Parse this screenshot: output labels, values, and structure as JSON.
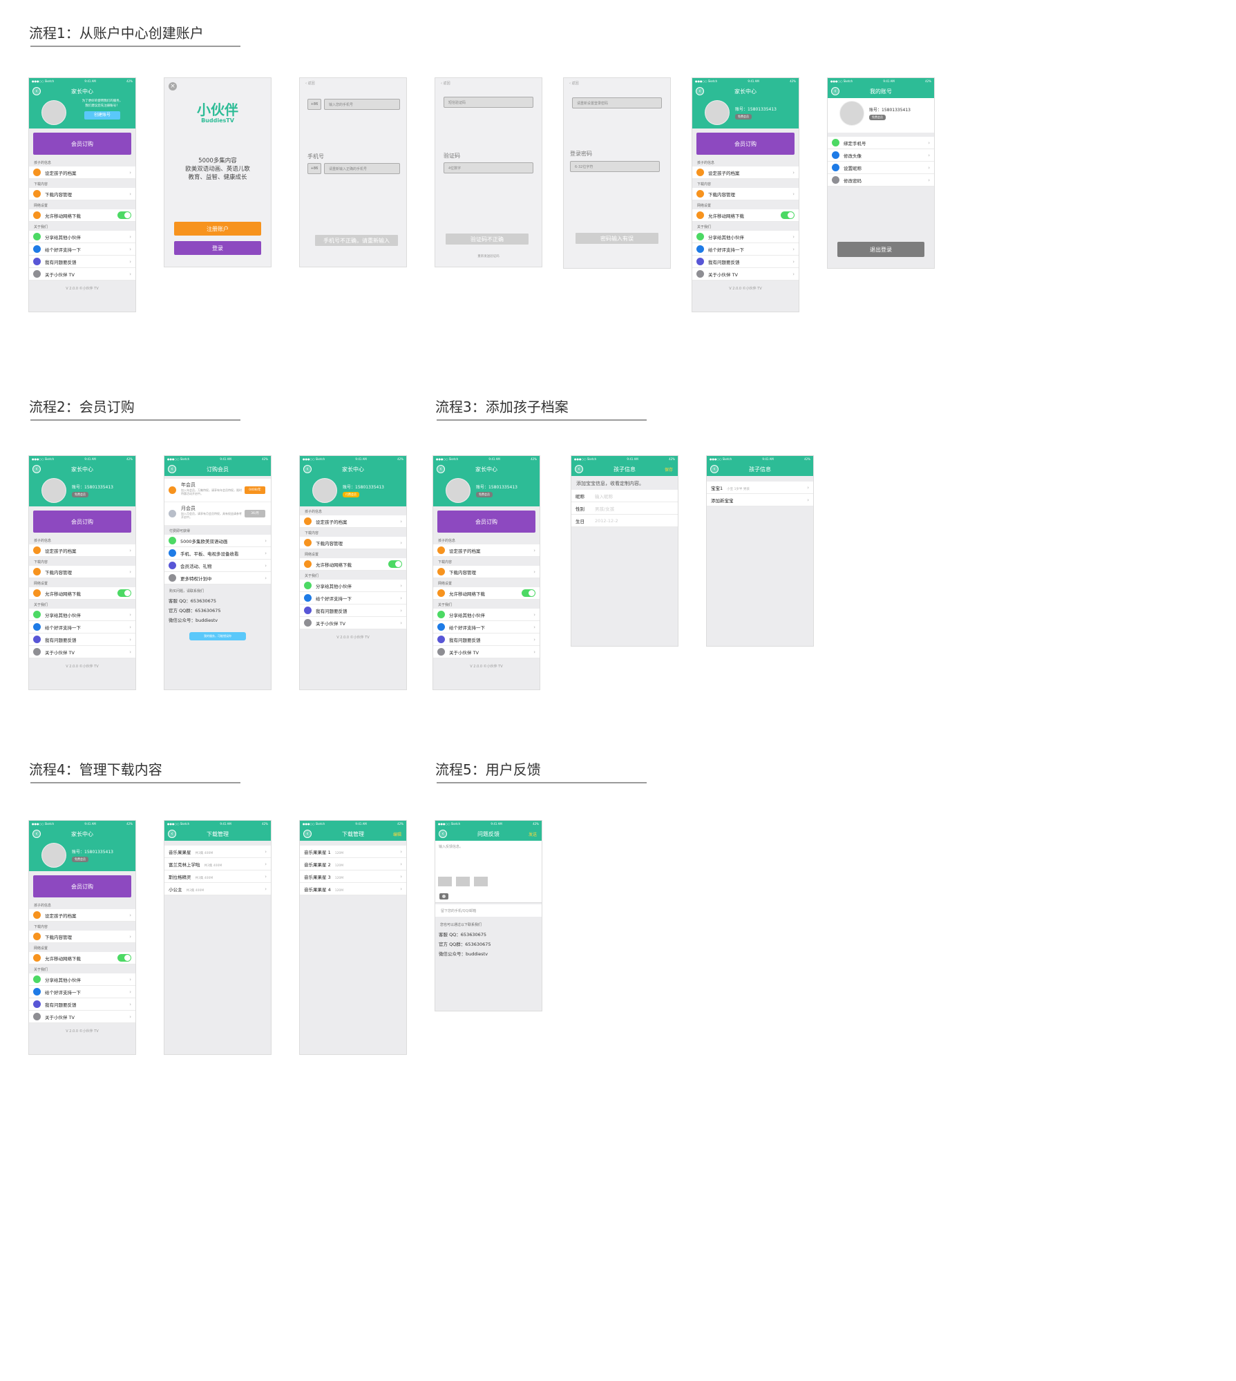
{
  "sections": {
    "s1": "流程1：从账户中心创建账户",
    "s2": "流程2：会员订购",
    "s3": "流程3：添加孩子档案",
    "s4": "流程4：管理下载内容",
    "s5": "流程5：用户反馈"
  },
  "status_bar": {
    "carrier": "●●●○○ Sketch",
    "time": "9:41 AM",
    "battery": "42%"
  },
  "family_center": {
    "title": "家长中心",
    "promo_line1": "为了更好的使用我们的服务，",
    "promo_line2": "我们建议您先注册账号！",
    "create_account": "创建账号",
    "account_number": "账号：15801335413",
    "badge_free": "免费会员",
    "badge_member": "付费会员",
    "membership_button": "会员订购",
    "group_child": "孩子的信息",
    "set_child": "设定孩子的档案",
    "group_download": "下载内容",
    "download_manage": "下载内容管理",
    "group_network": "网络设置",
    "allow_mobile": "允许移动网络下载",
    "group_about": "关于我们",
    "share": "分享给其他小伙伴",
    "rate": "给个好评支持一下",
    "feedback": "我有问题要反馈",
    "about": "关于小伙伴 TV",
    "version": "V 2.0.0 ©小伙伴 TV",
    "chevron": "›"
  },
  "welcome": {
    "close": "×",
    "logo_cn": "小伙伴",
    "logo_en": "BuddiesTV",
    "line1": "5000多集内容",
    "line2": "欧美双语动画、英语儿歌",
    "line3": "教育、益智、健康成长",
    "register": "注册账户",
    "login": "登录"
  },
  "phone_screen": {
    "back": "‹ 返回",
    "prefix": "+86",
    "placeholder1": "输入您的手机号",
    "label": "手机号",
    "placeholder2": "请重新输入正确的手机号",
    "error": "手机号不正确，请重新输入"
  },
  "code_screen": {
    "back": "‹ 返回",
    "placeholder1": "短信验证码",
    "label": "验证码",
    "placeholder2": "4位数字",
    "error": "验证码不正确",
    "resend": "重新发送验证码"
  },
  "password_screen": {
    "back": "‹ 返回",
    "placeholder1": "请重新设置登录密码",
    "label": "登录密码",
    "placeholder2": "6-32位字符",
    "error": "密码输入有误"
  },
  "my_account": {
    "title": "我的账号",
    "account_number": "账号：15801335413",
    "badge": "免费会员",
    "items": [
      "绑定手机号",
      "修改头像",
      "设置昵称",
      "修改密码"
    ],
    "logout": "退出登录"
  },
  "subscribe": {
    "title": "订购会员",
    "yearly": "年会员",
    "yearly_desc": "加入年会员，万集特权，请享有年会员特权，限时特惠活动开启中。",
    "yearly_price": "0408/年",
    "monthly": "月会员",
    "monthly_desc": "加入月会员，请享有月会员特权，具有权益请参考开启中。",
    "monthly_price": "36/月",
    "perks_title": "付费即可获得",
    "perks": [
      "5000多集欧美双语动画",
      "手机、平板、电视多设备收看",
      "会员活动、礼物",
      "更多特权计划中"
    ],
    "contact_title": "购买问题，请联系我们",
    "qq": "客服 QQ：653630675",
    "qq_group": "官方 QQ群：653630675",
    "wechat": "微信公众号：buddiestv",
    "button": "我的服务，可能错误你"
  },
  "child_info": {
    "title": "孩子信息",
    "save": "保存",
    "hint": "添加宝宝信息，收看定制内容。",
    "nickname_label": "昵称",
    "nickname_ph": "输入昵称",
    "gender_label": "性别",
    "gender_ph": "男孩/女孩",
    "birthday_label": "生日",
    "birthday_ph": "2012-12-2"
  },
  "child_list": {
    "title": "孩子信息",
    "baby1": "宝宝1",
    "baby1_info": "小宝 1岁半 男孩",
    "add": "添加新宝宝"
  },
  "downloads": {
    "title": "下载管理",
    "edit": "编辑",
    "items": [
      {
        "name": "音乐果果星",
        "meta": "共3集 400M"
      },
      {
        "name": "富兰克林上学啦",
        "meta": "共3集 400M"
      },
      {
        "name": "斯拉格精灵",
        "meta": "共3集 400M"
      },
      {
        "name": "小公主",
        "meta": "共3集 400M"
      }
    ],
    "episodes": [
      {
        "name": "音乐果果星 1",
        "meta": "120M"
      },
      {
        "name": "音乐果果星 2",
        "meta": "120M"
      },
      {
        "name": "音乐果果星 3",
        "meta": "120M"
      },
      {
        "name": "音乐果果星 4",
        "meta": "120M"
      }
    ]
  },
  "feedback_screen": {
    "title": "问题反馈",
    "send": "发送",
    "placeholder": "输入反馈信息。",
    "contact_ph": "留下您的手机/QQ/邮箱",
    "contact_title": "您也可以通过以下联系我们",
    "qq": "客服 QQ：653630675",
    "qq_group": "官方 QQ群：653630675",
    "wechat": "微信公众号：buddiestv"
  },
  "colors": {
    "green": "#2dbc96",
    "purple": "#8d49c0",
    "orange": "#f7931e",
    "dot_green": "#4cd964",
    "dot_blue": "#1e7be6",
    "dot_indigo": "#5856d6",
    "dot_gray": "#8e8e93"
  }
}
